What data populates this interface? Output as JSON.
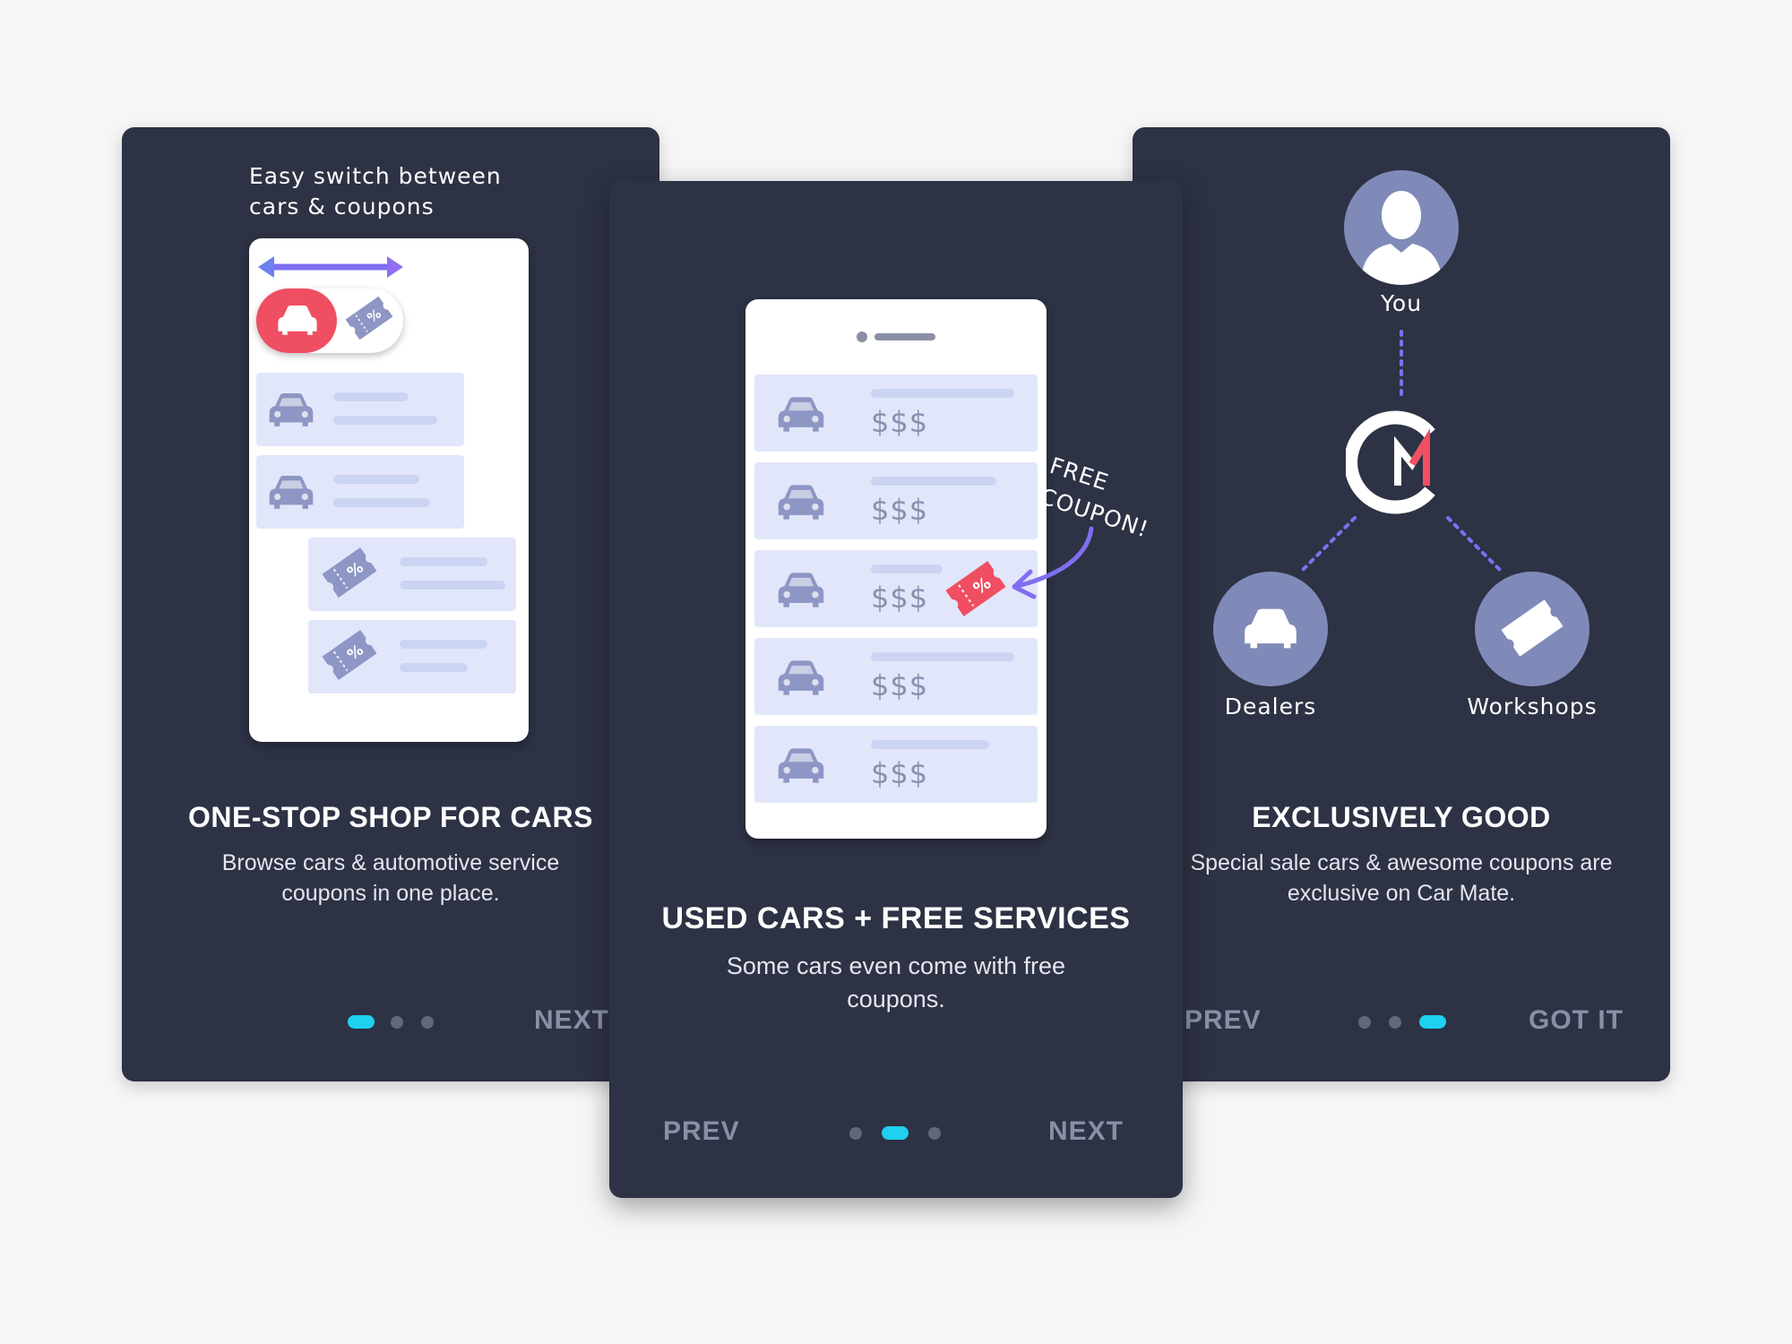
{
  "screens": [
    {
      "note": "Easy switch between cars & coupons",
      "title": "ONE-STOP SHOP FOR CARS",
      "description": "Browse cars & automotive service coupons in one place.",
      "next_label": "NEXT",
      "active_dot": 0
    },
    {
      "annotation": "FREE COUPON!",
      "price_label": "$$$",
      "title": "USED CARS + FREE SERVICES",
      "description": "Some cars even come with free coupons.",
      "prev_label": "PREV",
      "next_label": "NEXT",
      "active_dot": 1
    },
    {
      "you_label": "You",
      "dealers_label": "Dealers",
      "workshops_label": "Workshops",
      "title": "EXCLUSIVELY GOOD",
      "description": "Special sale cars & awesome coupons are exclusive on Car Mate.",
      "prev_label": "PREV",
      "done_label": "GOT IT",
      "active_dot": 2
    }
  ],
  "icons": {
    "car": "car-icon",
    "coupon": "coupon-icon",
    "user": "user-avatar-icon",
    "logo": "car-mate-logo",
    "swap": "double-arrow-icon"
  },
  "colors": {
    "card_bg": "#2d3244",
    "accent_dot": "#1fd0f0",
    "brand_red": "#f04e62",
    "row_bg": "#e1e6fa",
    "icon_grey": "#8d96c4",
    "arrow_purple": "#7f6ff0"
  }
}
